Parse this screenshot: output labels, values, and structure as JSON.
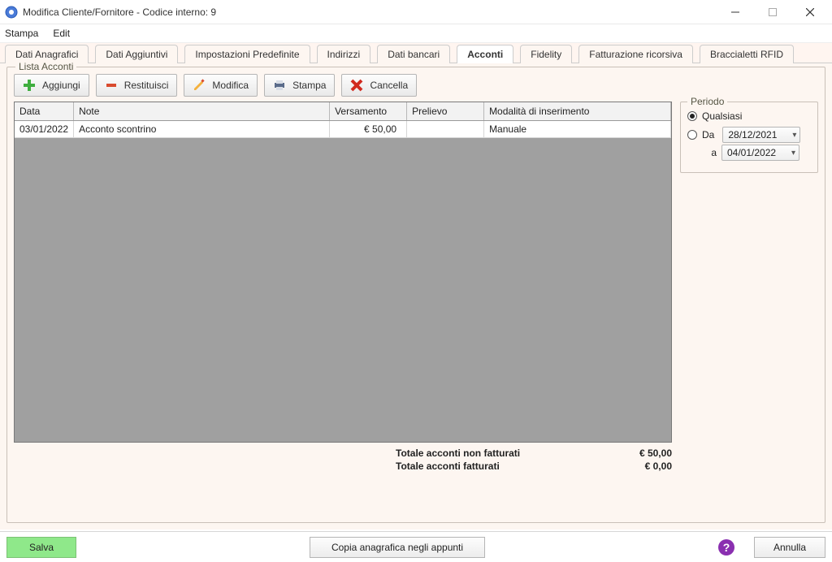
{
  "window": {
    "title": "Modifica Cliente/Fornitore - Codice interno: 9"
  },
  "menu": {
    "stampa": "Stampa",
    "edit": "Edit"
  },
  "tabs": [
    {
      "label": "Dati Anagrafici"
    },
    {
      "label": "Dati Aggiuntivi"
    },
    {
      "label": "Impostazioni Predefinite"
    },
    {
      "label": "Indirizzi"
    },
    {
      "label": "Dati bancari"
    },
    {
      "label": "Acconti"
    },
    {
      "label": "Fidelity"
    },
    {
      "label": "Fatturazione ricorsiva"
    },
    {
      "label": "Braccialetti RFID"
    }
  ],
  "group": {
    "title": "Lista Acconti"
  },
  "toolbar": {
    "add_label": "Aggiungi",
    "return_label": "Restituisci",
    "edit_label": "Modifica",
    "print_label": "Stampa",
    "delete_label": "Cancella"
  },
  "table": {
    "headers": {
      "data": "Data",
      "note": "Note",
      "versamento": "Versamento",
      "prelievo": "Prelievo",
      "modalita": "Modalità di inserimento"
    },
    "rows": [
      {
        "data": "03/01/2022",
        "note": "Acconto scontrino",
        "versamento": "€ 50,00",
        "prelievo": "",
        "modalita": "Manuale"
      }
    ]
  },
  "totals": {
    "non_fatturati_label": "Totale acconti non fatturati",
    "non_fatturati_value": "€ 50,00",
    "fatturati_label": "Totale acconti fatturati",
    "fatturati_value": "€ 0,00"
  },
  "period": {
    "title": "Periodo",
    "any_label": "Qualsiasi",
    "from_label": "Da",
    "to_label": "a",
    "from_date": "28/12/2021",
    "to_date": "04/01/2022",
    "selected": "any"
  },
  "footer": {
    "save_label": "Salva",
    "copy_label": "Copia anagrafica negli appunti",
    "cancel_label": "Annulla"
  },
  "icons": {
    "add": "add-icon",
    "return": "minus-icon",
    "edit": "pencil-icon",
    "print": "printer-icon",
    "delete": "x-icon",
    "help": "question-icon",
    "chevron": "chevron-down-icon",
    "minimize": "minimize-icon",
    "maximize": "maximize-icon",
    "close": "close-icon"
  }
}
